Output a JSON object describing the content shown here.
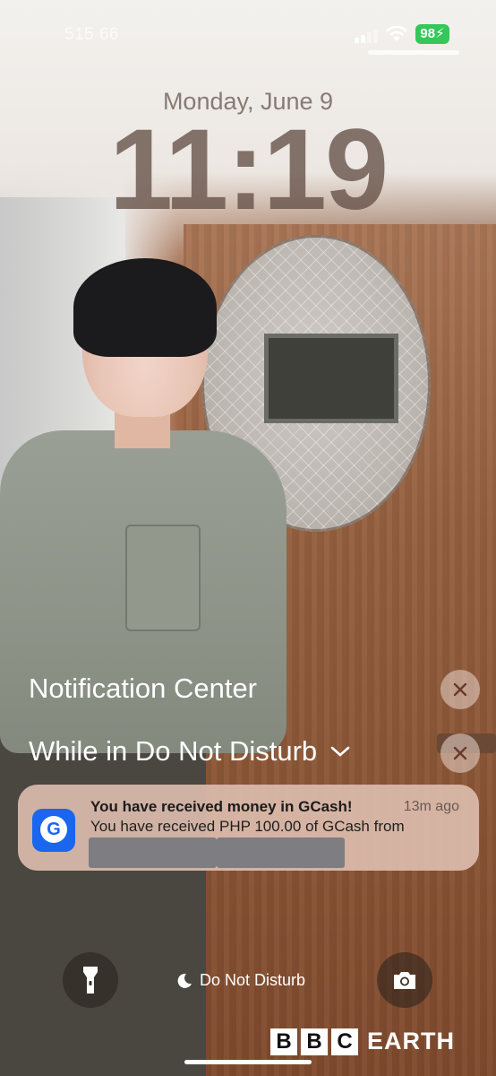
{
  "status_bar": {
    "carrier": "515 66",
    "battery": "98"
  },
  "lock_screen": {
    "date": "Monday, June 9",
    "time": "11:19"
  },
  "notification_center": {
    "title": "Notification Center",
    "focus_group_title": "While in Do Not Disturb",
    "notification": {
      "app": "GCash",
      "app_icon_letter": "G",
      "title": "You have received money in GCash!",
      "time": "13m ago",
      "body": "You have received PHP 100.00 of GCash from"
    }
  },
  "bottom": {
    "focus_label": "Do Not Disturb"
  },
  "watermark": {
    "letters": [
      "B",
      "B",
      "C"
    ],
    "word": "EARTH"
  },
  "colors": {
    "battery": "#34c759",
    "gcash_blue": "#1a66ee"
  }
}
